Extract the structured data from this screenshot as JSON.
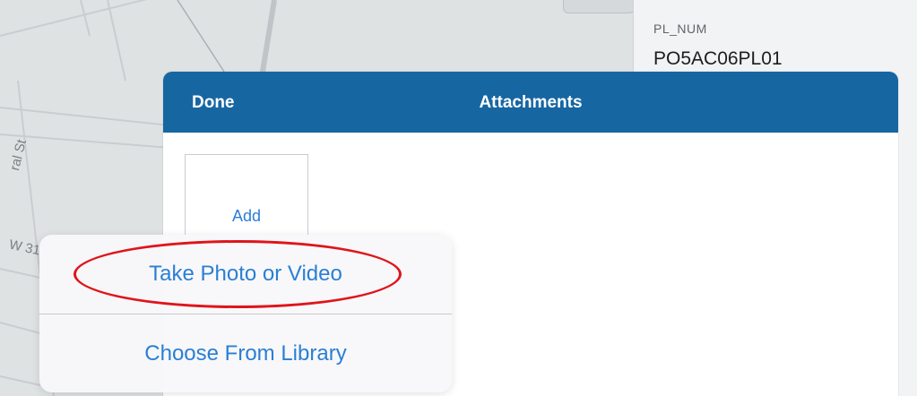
{
  "map": {
    "street_label_1": "ral St",
    "street_label_2": "W 31"
  },
  "attribute_panel": {
    "field_label": "PL_NUM",
    "field_value": "PO5AC06PL01"
  },
  "attachments_modal": {
    "done_label": "Done",
    "title": "Attachments",
    "add_tile_label": "Add"
  },
  "action_sheet": {
    "options": [
      {
        "label": "Take Photo or Video"
      },
      {
        "label": "Choose From Library"
      }
    ]
  },
  "colors": {
    "header_blue": "#1666a2",
    "ios_blue": "#2a7fd4",
    "annotation_red": "#e0141b"
  }
}
